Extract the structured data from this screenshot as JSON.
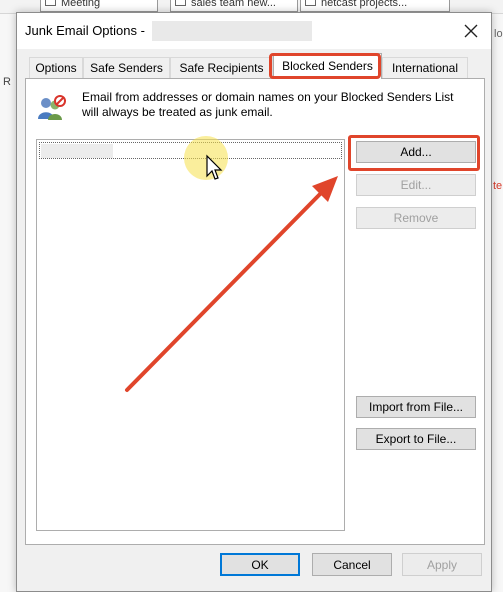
{
  "background": {
    "tab_left_label": "Meeting",
    "tab_mid_label": "sales team new...",
    "tab_right_label": "netcast projects...",
    "left_letter": "R",
    "right_letter": "lo",
    "right_red_letter": "te"
  },
  "dialog": {
    "title": "Junk Email Options -",
    "close_glyph": "✕",
    "tabs": [
      {
        "label": "Options"
      },
      {
        "label": "Safe Senders"
      },
      {
        "label": "Safe Recipients"
      },
      {
        "label": "Blocked Senders",
        "active": true
      },
      {
        "label": "International"
      }
    ],
    "description": "Email from addresses or domain names on your Blocked Senders List will always be treated as junk email.",
    "buttons": {
      "add": "Add...",
      "edit": "Edit...",
      "remove": "Remove",
      "import": "Import from File...",
      "export": "Export to File..."
    },
    "footer": {
      "ok": "OK",
      "cancel": "Cancel",
      "apply": "Apply"
    }
  },
  "colors": {
    "highlight": "#e0452b",
    "focus": "#0078d7",
    "cursor_glow": "#f5e04a"
  },
  "icons": {
    "panel_icon": "blocked-users-icon",
    "close": "close-icon",
    "cursor": "mouse-pointer-icon"
  }
}
